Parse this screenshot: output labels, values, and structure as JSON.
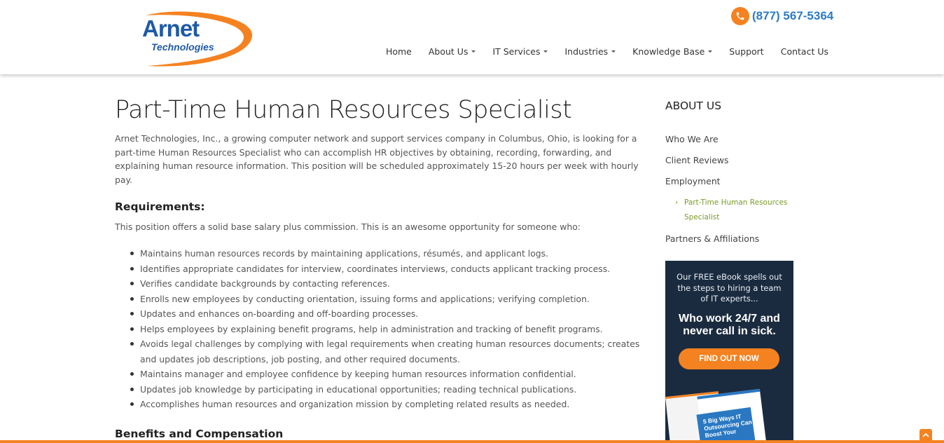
{
  "header": {
    "logo_word": "Arnet",
    "logo_sub": "Technologies",
    "phone": "(877) 567-5364",
    "nav": [
      {
        "label": "Home",
        "dropdown": false
      },
      {
        "label": "About Us",
        "dropdown": true
      },
      {
        "label": "IT Services",
        "dropdown": true
      },
      {
        "label": "Industries",
        "dropdown": true
      },
      {
        "label": "Knowledge Base",
        "dropdown": true
      },
      {
        "label": "Support",
        "dropdown": false
      },
      {
        "label": "Contact Us",
        "dropdown": false
      }
    ]
  },
  "main": {
    "title": "Part-Time Human Resources Specialist",
    "intro": "Arnet Technologies, Inc., a growing computer network and support services company in Columbus, Ohio, is looking for a part-time Human Resources Specialist who can accomplish HR objectives by obtaining, recording, forwarding, and explaining human resource information. This position will be scheduled approximately 15-20 hours per week with hourly pay.",
    "requirements_heading": "Requirements:",
    "requirements_lead": "This position offers a solid base salary plus commission. This is an awesome opportunity for someone who:",
    "requirements": [
      "Maintains human resources records by maintaining applications, résumés, and applicant logs.",
      "Identifies appropriate candidates for interview, coordinates interviews, conducts applicant tracking process.",
      "Verifies candidate backgrounds by contacting references.",
      "Enrolls new employees by conducting orientation, issuing forms and applications; verifying completion.",
      "Updates and enhances on-boarding and off-boarding processes.",
      "Helps employees by explaining benefit programs, help in administration and tracking of benefit programs.",
      "Avoids legal challenges by complying with legal requirements when creating human resources documents; creates and updates job descriptions, job posting, and other required documents.",
      "Maintains manager and employee confidence by keeping human resources information confidential.",
      "Updates job knowledge by participating in educational opportunities; reading technical publications.",
      "Accomplishes human resources and organization mission by completing related results as needed."
    ],
    "benefits_heading": "Benefits and Compensation"
  },
  "sidebar": {
    "heading": "ABOUT US",
    "links": [
      "Who We Are",
      "Client Reviews",
      "Employment"
    ],
    "sub_link": "Part-Time Human Resources Specialist",
    "last_link": "Partners & Affiliations"
  },
  "ad": {
    "text": "Our FREE eBook spells out the steps to hiring a team of IT experts...",
    "bold": "Who work 24/7 and never call in sick.",
    "button": "FIND OUT NOW",
    "book_title": "5 Big Ways IT Outsourcing Can Boost Your"
  },
  "colors": {
    "accent": "#f58220",
    "link_blue": "#2e7bc4",
    "sub_link_green": "#7a9b2a",
    "ad_background": "#1b2b3f"
  }
}
